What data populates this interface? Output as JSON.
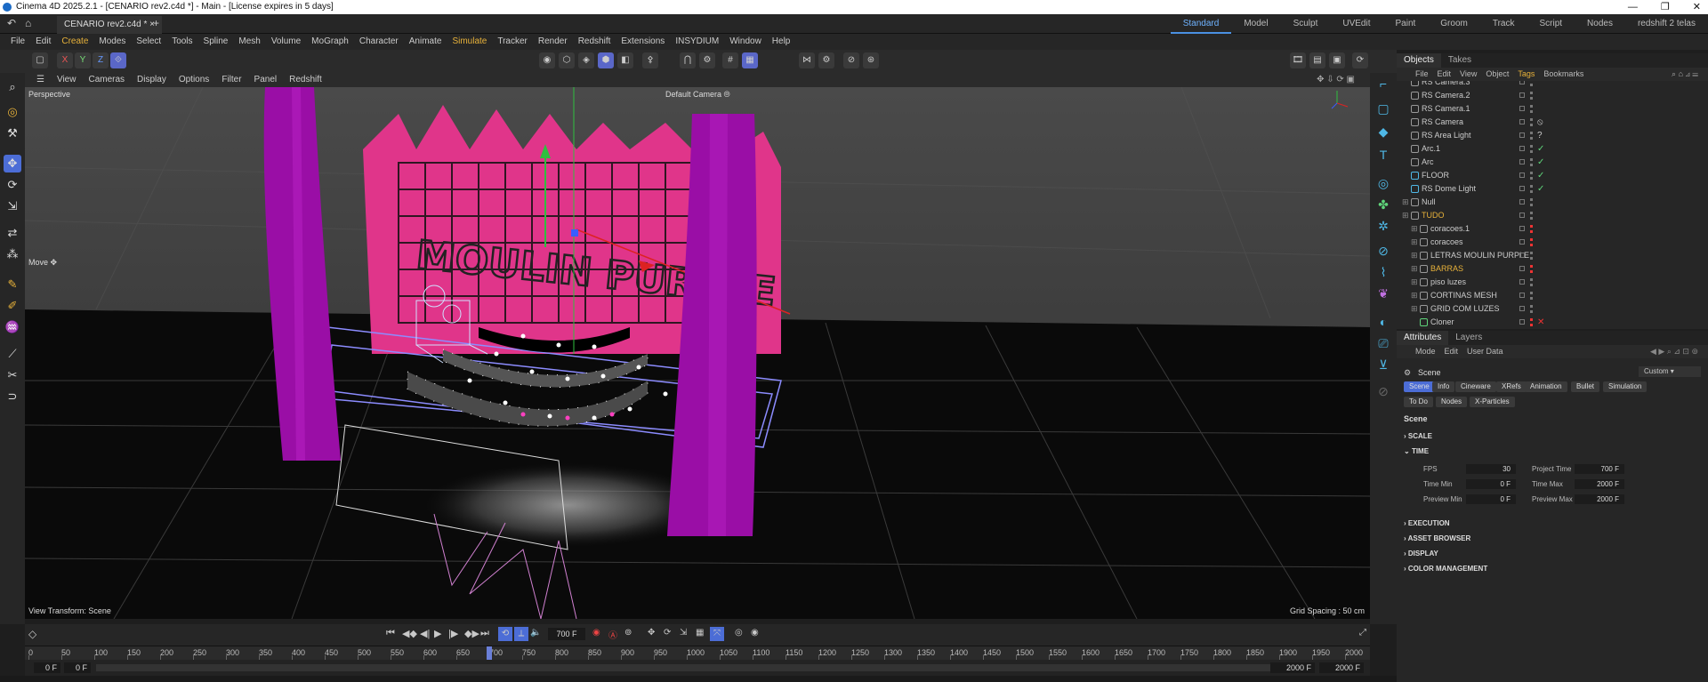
{
  "window": {
    "title": "Cinema 4D 2025.2.1 - [CENARIO rev2.c4d *] - Main - [License expires in 5 days]",
    "minimize": "—",
    "maximize": "❐",
    "close": "✕"
  },
  "tabs": {
    "doc_tab": "CENARIO rev2.c4d *",
    "add": "+"
  },
  "layouts": [
    "Standard",
    "Model",
    "Sculpt",
    "UVEdit",
    "Paint",
    "Groom",
    "Track",
    "Script",
    "Nodes",
    "redshift 2 telas"
  ],
  "menu": [
    "File",
    "Edit",
    "Create",
    "Modes",
    "Select",
    "Tools",
    "Spline",
    "Mesh",
    "Volume",
    "MoGraph",
    "Character",
    "Animate",
    "Simulate",
    "Tracker",
    "Render",
    "Redshift",
    "Extensions",
    "INSYDIUM",
    "Window",
    "Help"
  ],
  "axis_buttons": [
    "X",
    "Y",
    "Z"
  ],
  "viewport_menu": [
    "View",
    "Cameras",
    "Display",
    "Options",
    "Filter",
    "Panel",
    "Redshift"
  ],
  "viewport": {
    "projection": "Perspective",
    "camera": "Default Camera",
    "camera_icon": "⦾",
    "tool_label": "Move",
    "tool_icon": "✥",
    "view_transform": "View Transform: Scene",
    "grid_spacing": "Grid Spacing : 50 cm",
    "sign_text": "MOULIN PURPLE"
  },
  "timeline": {
    "current_frame": "700 F",
    "ticks": [
      "0",
      "50",
      "100",
      "150",
      "200",
      "250",
      "300",
      "350",
      "400",
      "450",
      "500",
      "550",
      "600",
      "650",
      "700",
      "750",
      "800",
      "850",
      "900",
      "950",
      "1000",
      "1050",
      "1100",
      "1150",
      "1200",
      "1250",
      "1300",
      "1350",
      "1400",
      "1450",
      "1500",
      "1550",
      "1600",
      "1650",
      "1700",
      "1750",
      "1800",
      "1850",
      "1900",
      "1950",
      "2000"
    ],
    "playhead_fraction": 0.35,
    "start_a": "0 F",
    "start_b": "0 F",
    "end_a": "2000 F",
    "end_b": "2000 F"
  },
  "objects_panel": {
    "tabs": [
      "Objects",
      "Takes"
    ],
    "menu": [
      "File",
      "Edit",
      "View",
      "Object",
      "Tags",
      "Bookmarks"
    ],
    "rows": [
      {
        "name": "RS Camera.3",
        "tag": ""
      },
      {
        "name": "RS Camera.2",
        "tag": ""
      },
      {
        "name": "RS Camera.1",
        "tag": ""
      },
      {
        "name": "RS Camera",
        "tag": "⦸"
      },
      {
        "name": "RS Area Light",
        "tag": "?"
      },
      {
        "name": "Arc.1",
        "tag": "✓"
      },
      {
        "name": "Arc",
        "tag": "✓"
      },
      {
        "name": "FLOOR",
        "tag": "✓"
      },
      {
        "name": "RS Dome Light",
        "tag": "✓"
      },
      {
        "name": "Null",
        "tag": ""
      },
      {
        "name": "TUDO",
        "tag": ""
      },
      {
        "name": "coracoes.1",
        "tag": ""
      },
      {
        "name": "coracoes",
        "tag": ""
      },
      {
        "name": "LETRAS MOULIN PURPLE",
        "tag": ""
      },
      {
        "name": "BARRAS",
        "tag": ""
      },
      {
        "name": "piso luzes",
        "tag": ""
      },
      {
        "name": "CORTINAS MESH",
        "tag": ""
      },
      {
        "name": "GRID COM LUZES",
        "tag": ""
      },
      {
        "name": "Cloner",
        "tag": "✕"
      }
    ]
  },
  "attributes_panel": {
    "tabs": [
      "Attributes",
      "Layers"
    ],
    "menu": [
      "Mode",
      "Edit",
      "User Data"
    ],
    "object": "Scene",
    "preset": "Custom",
    "scene_tabs_row1": [
      "Scene",
      "Info",
      "Cineware",
      "XRefs",
      "Animation",
      "Bullet",
      "Simulation"
    ],
    "scene_tabs_row2": [
      "To Do",
      "Nodes",
      "X-Particles"
    ],
    "heading": "Scene",
    "sections": {
      "scale": "SCALE",
      "time": "TIME",
      "execution": "EXECUTION",
      "asset_browser": "ASSET BROWSER",
      "display": "DISPLAY",
      "color_management": "COLOR MANAGEMENT"
    },
    "fields": {
      "fps_label": "FPS",
      "fps": "30",
      "project_time_label": "Project Time",
      "project_time": "700 F",
      "time_min_label": "Time Min",
      "time_min": "0 F",
      "time_max_label": "Time Max",
      "time_max": "2000 F",
      "preview_min_label": "Preview Min",
      "preview_min": "0 F",
      "preview_max_label": "Preview Max",
      "preview_max": "2000 F"
    }
  },
  "colors": {
    "accent": "#4a90e2",
    "curtain_purple": "#9a0ea6",
    "sign_pink": "#e0358a",
    "light_pink": "#ff40c0"
  }
}
